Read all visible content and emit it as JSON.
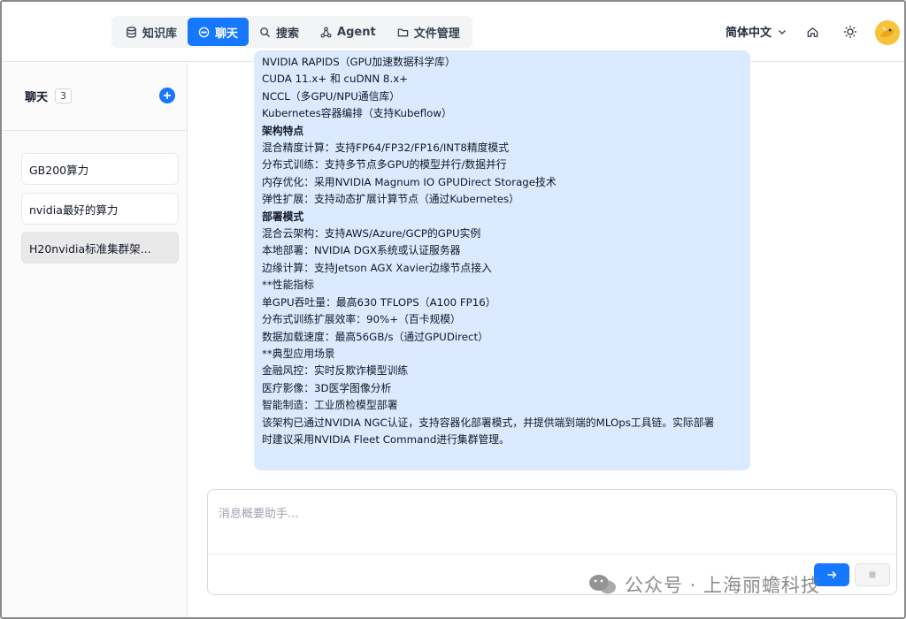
{
  "nav": {
    "tabs": [
      {
        "label": "知识库",
        "icon": "database-icon"
      },
      {
        "label": "聊天",
        "icon": "chat-icon"
      },
      {
        "label": "搜索",
        "icon": "search-icon"
      },
      {
        "label": "Agent",
        "icon": "agent-graph-icon"
      },
      {
        "label": "文件管理",
        "icon": "folder-icon"
      }
    ],
    "active_tab": "聊天",
    "language": "简体中文",
    "accent": "#1677ff"
  },
  "sidebar": {
    "title": "聊天",
    "count": "3",
    "conversations": [
      {
        "label": "GB200算力"
      },
      {
        "label": "nvidia最好的算力"
      },
      {
        "label": "H20nvidia标准集群架..."
      }
    ],
    "active_index": 2
  },
  "message": {
    "lines": [
      {
        "text": "NVIDIA RAPIDS（GPU加速数据科学库）",
        "bold": false
      },
      {
        "text": "CUDA 11.x+ 和 cuDNN 8.x+",
        "bold": false
      },
      {
        "text": "NCCL（多GPU/NPU通信库）",
        "bold": false
      },
      {
        "text": "Kubernetes容器编排（支持Kubeflow）",
        "bold": false
      },
      {
        "text": "架构特点",
        "bold": true
      },
      {
        "text": "混合精度计算：支持FP64/FP32/FP16/INT8精度模式",
        "bold": false
      },
      {
        "text": "分布式训练：支持多节点多GPU的模型并行/数据并行",
        "bold": false
      },
      {
        "text": "内存优化：采用NVIDIA Magnum IO GPUDirect Storage技术",
        "bold": false
      },
      {
        "text": "弹性扩展：支持动态扩展计算节点（通过Kubernetes）",
        "bold": false
      },
      {
        "text": "部署模式",
        "bold": true
      },
      {
        "text": "混合云架构：支持AWS/Azure/GCP的GPU实例",
        "bold": false
      },
      {
        "text": "本地部署：NVIDIA DGX系统或认证服务器",
        "bold": false
      },
      {
        "text": "边缘计算：支持Jetson AGX Xavier边缘节点接入",
        "bold": false
      },
      {
        "text": "**性能指标",
        "bold": false
      },
      {
        "text": "单GPU吞吐量：最高630 TFLOPS（A100 FP16）",
        "bold": false
      },
      {
        "text": "分布式训练扩展效率：90%+（百卡规模）",
        "bold": false
      },
      {
        "text": "数据加载速度：最高56GB/s（通过GPUDirect）",
        "bold": false
      },
      {
        "text": "**典型应用场景",
        "bold": false
      },
      {
        "text": "金融风控：实时反欺诈模型训练",
        "bold": false
      },
      {
        "text": "医疗影像：3D医学图像分析",
        "bold": false
      },
      {
        "text": "智能制造：工业质检模型部署",
        "bold": false
      },
      {
        "text": "该架构已通过NVIDIA NGC认证，支持容器化部署模式，并提供端到端的MLOps工具链。实际部署",
        "bold": false
      },
      {
        "text": "时建议采用NVIDIA Fleet Command进行集群管理。",
        "bold": false
      }
    ]
  },
  "composer": {
    "placeholder": "消息概要助手...",
    "value": ""
  },
  "watermark": "公众号 · 上海丽蟾科技"
}
